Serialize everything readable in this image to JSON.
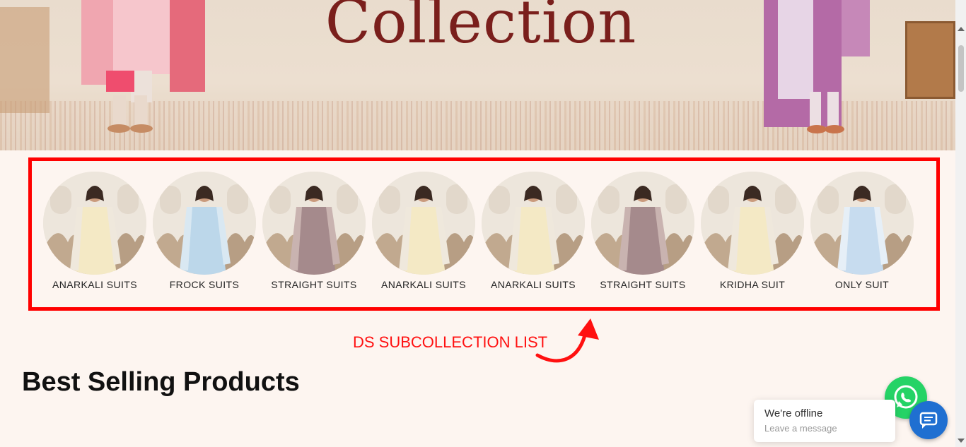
{
  "hero": {
    "title": "Collection"
  },
  "subcollections": [
    {
      "label": "ANARKALI SUITS",
      "dress": "#f4e9c5",
      "dupatta": "#efe8dc"
    },
    {
      "label": "FROCK SUITS",
      "dress": "#bcd7ea",
      "dupatta": "#d9e8f2"
    },
    {
      "label": "STRAIGHT SUITS",
      "dress": "#a58a8c",
      "dupatta": "#c9b3b0"
    },
    {
      "label": "ANARKALI SUITS",
      "dress": "#f4e9c5",
      "dupatta": "#efe8dc"
    },
    {
      "label": "ANARKALI SUITS",
      "dress": "#f4e9c5",
      "dupatta": "#efe8dc"
    },
    {
      "label": "STRAIGHT SUITS",
      "dress": "#a58a8c",
      "dupatta": "#c9b3b0"
    },
    {
      "label": "KRIDHA SUIT",
      "dress": "#f4e9c5",
      "dupatta": "#efe8dc"
    },
    {
      "label": "ONLY SUIT",
      "dress": "#c7dcef",
      "dupatta": "#e6eff7"
    }
  ],
  "annotation": {
    "text": "DS SUBCOLLECTION LIST",
    "color": "#ff0000"
  },
  "section": {
    "title": "Best Selling Products"
  },
  "chat": {
    "title": "We're offline",
    "subtitle": "Leave a message"
  },
  "icons": {
    "whatsapp": "whatsapp-icon",
    "chat": "chat-bubble-icon"
  }
}
